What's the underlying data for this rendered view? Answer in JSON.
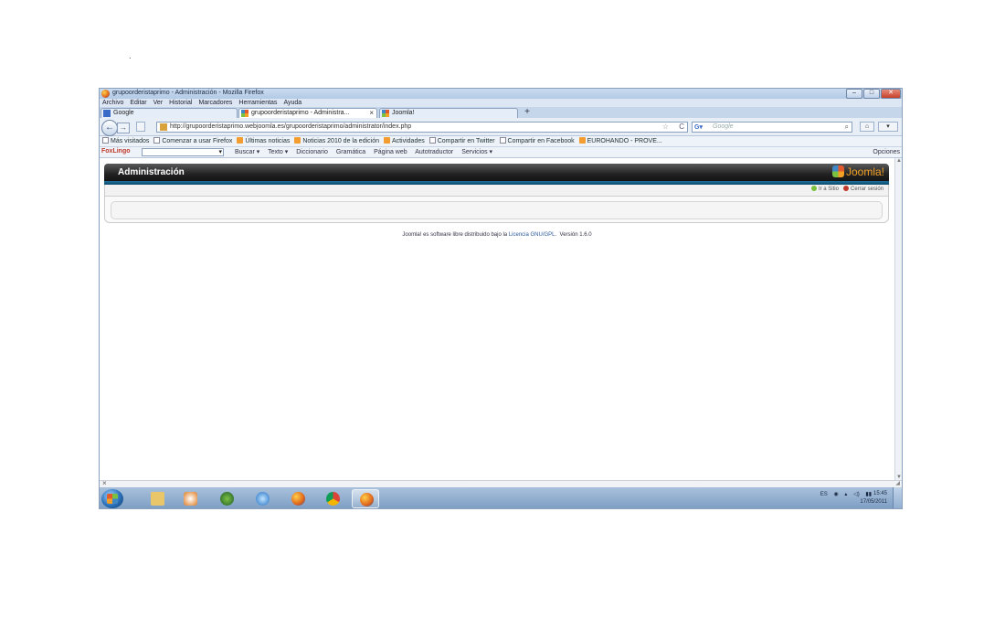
{
  "page_dot": ".",
  "window": {
    "title": "grupoorderistaprimo - Administración - Mozilla Firefox",
    "controls": {
      "minimize": "–",
      "maximize": "□",
      "close": "✕"
    }
  },
  "menu": [
    "Archivo",
    "Editar",
    "Ver",
    "Historial",
    "Marcadores",
    "Herramientas",
    "Ayuda"
  ],
  "tabs": [
    {
      "label": "Google",
      "icon": "google-icon",
      "active": false
    },
    {
      "label": "grupoorderistaprimo - Administra...",
      "icon": "joomla-favicon",
      "active": true,
      "close": "×"
    },
    {
      "label": "Joomla!",
      "icon": "joomla-favicon",
      "active": false
    }
  ],
  "new_tab": "+",
  "nav": {
    "back": "←",
    "forward": "→",
    "url": "http://grupoorderistaprimo.webjoomla.es/grupoorderistaprimo/administrator/index.php",
    "search_engine": "Google",
    "search_placeholder": "Google",
    "search_glyph": "⌕",
    "home": "⌂",
    "star": "☆",
    "reload": "C",
    "menu_arrow": "▾"
  },
  "bookmarks": [
    {
      "label": "Más visitados",
      "icon": "page"
    },
    {
      "label": "Comenzar a usar Firefox",
      "icon": "page"
    },
    {
      "label": "Últimas noticias",
      "icon": "rss"
    },
    {
      "label": "Noticias 2010 de la edición",
      "icon": "rss"
    },
    {
      "label": "Actividades",
      "icon": "rss"
    },
    {
      "label": "Compartir en Twitter",
      "icon": "page"
    },
    {
      "label": "Compartir en Facebook",
      "icon": "page"
    },
    {
      "label": "EUROHANDO - PROVE...",
      "icon": "rss"
    }
  ],
  "foxlingo": {
    "label": "FoxLingo",
    "items": [
      "Buscar ▾",
      "Texto ▾",
      "Diccionario",
      "Gramática",
      "Página web",
      "Autotraductor",
      "Servicios ▾"
    ],
    "options": "Opciones"
  },
  "joomla": {
    "header_title": "Administración",
    "logo_text": "Joomla!",
    "status_links": [
      "Ir a Sitio",
      "Cerrar sesión"
    ],
    "footer_prefix": "Joomla! es software libre distribuido bajo la",
    "footer_link": "Licencia GNU/GPL.",
    "footer_version": "Versión 1.6.0"
  },
  "status_close": "×",
  "taskbar": {
    "apps": [
      {
        "name": "explorer",
        "active": false
      },
      {
        "name": "media-player",
        "active": false
      },
      {
        "name": "app-globe",
        "active": false
      },
      {
        "name": "internet-explorer",
        "active": false
      },
      {
        "name": "firefox",
        "active": false
      },
      {
        "name": "chrome",
        "active": false
      },
      {
        "name": "firefox-active",
        "active": true
      }
    ],
    "tray_lang": "ES",
    "time": "15:45",
    "date": "17/05/2011"
  },
  "colors": {
    "joomla_header": "#222222",
    "joomla_bar": "#1f6f9a",
    "taskbar": "#7b9cc2"
  }
}
